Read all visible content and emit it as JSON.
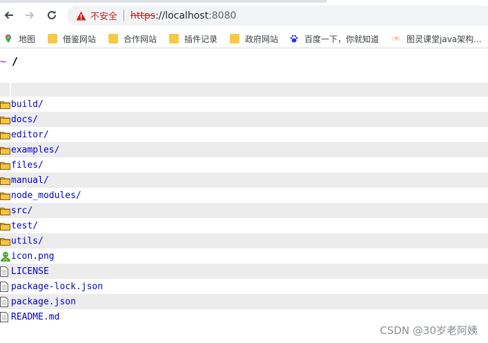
{
  "browser": {
    "security_label": "不安全",
    "url": {
      "scheme": "https",
      "host": "://localhost",
      "port": ":8080"
    }
  },
  "bookmarks": [
    {
      "label": "地图",
      "icon": "maps-icon"
    },
    {
      "label": "借鉴网站",
      "icon": "folder-icon"
    },
    {
      "label": "合作网站",
      "icon": "folder-icon"
    },
    {
      "label": "插件记录",
      "icon": "folder-icon"
    },
    {
      "label": "政府网站",
      "icon": "folder-icon"
    },
    {
      "label": "百度一下，你就知道",
      "icon": "baidu-icon"
    },
    {
      "label": "图灵课堂java架构...",
      "icon": "tuling-icon"
    }
  ],
  "page": {
    "tilde": "~",
    "path": "/",
    "files": [
      {
        "name": "build/",
        "icon": "folder-icon"
      },
      {
        "name": "docs/",
        "icon": "folder-icon"
      },
      {
        "name": "editor/",
        "icon": "folder-icon"
      },
      {
        "name": "examples/",
        "icon": "folder-icon"
      },
      {
        "name": "files/",
        "icon": "folder-icon"
      },
      {
        "name": "manual/",
        "icon": "folder-icon"
      },
      {
        "name": "node_modules/",
        "icon": "folder-icon"
      },
      {
        "name": "src/",
        "icon": "folder-icon"
      },
      {
        "name": "test/",
        "icon": "folder-icon"
      },
      {
        "name": "utils/",
        "icon": "folder-icon"
      },
      {
        "name": "icon.png",
        "icon": "image-icon"
      },
      {
        "name": "LICENSE",
        "icon": "file-icon"
      },
      {
        "name": "package-lock.json",
        "icon": "file-icon"
      },
      {
        "name": "package.json",
        "icon": "file-icon"
      },
      {
        "name": "README.md",
        "icon": "file-icon"
      }
    ]
  },
  "watermark": "CSDN @30岁老阿姨"
}
